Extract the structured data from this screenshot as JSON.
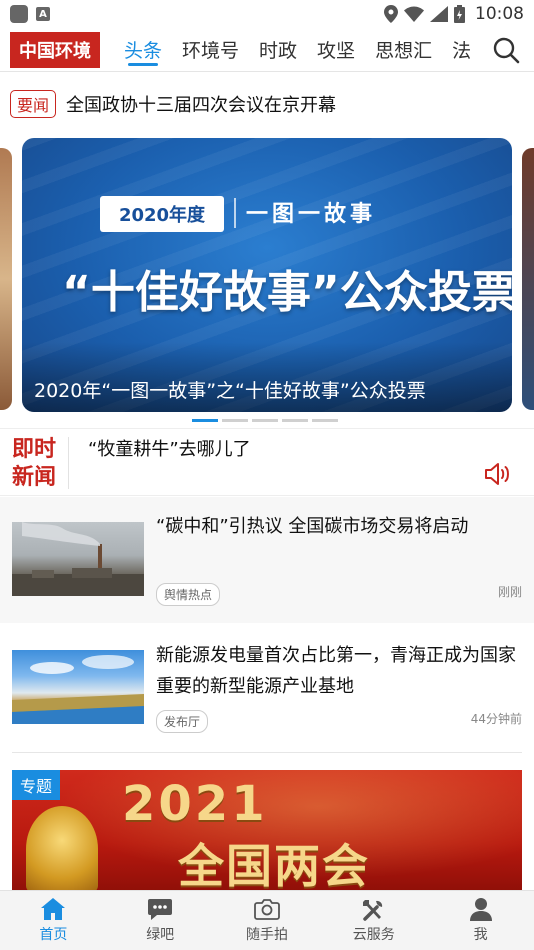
{
  "status_bar": {
    "time": "10:08"
  },
  "header": {
    "logo": "中国环境",
    "tabs": [
      {
        "label": "头条",
        "active": true
      },
      {
        "label": "环境号",
        "active": false
      },
      {
        "label": "时政",
        "active": false
      },
      {
        "label": "攻坚",
        "active": false
      },
      {
        "label": "思想汇",
        "active": false
      },
      {
        "label": "法",
        "active": false
      }
    ]
  },
  "top_headline": {
    "tag": "要闻",
    "text": "全国政协十三届四次会议在京开幕"
  },
  "carousel": {
    "year_badge": "2020年度",
    "series_name": "一图一故事",
    "big_title": "“十佳好故事”公众投票",
    "caption": "2020年“一图一故事”之“十佳好故事”公众投票",
    "total_slides": 5,
    "active_slide": 1
  },
  "flash_news": {
    "label_line1": "即时",
    "label_line2": "新闻",
    "text": "“牧童耕牛”去哪儿了"
  },
  "news": [
    {
      "title": "“碳中和”引热议 全国碳市场交易将启动",
      "tag": "舆情热点",
      "time": "刚刚"
    },
    {
      "title": "新能源发电量首次占比第一，青海正成为国家重要的新型能源产业基地",
      "tag": "发布厅",
      "time": "44分钟前"
    }
  ],
  "feature": {
    "tag": "专题",
    "year": "2021",
    "title": "全国两会"
  },
  "bottom_nav": [
    {
      "label": "首页",
      "icon": "home-icon",
      "active": true
    },
    {
      "label": "绿吧",
      "icon": "chat-icon",
      "active": false
    },
    {
      "label": "随手拍",
      "icon": "camera-icon",
      "active": false
    },
    {
      "label": "云服务",
      "icon": "tools-icon",
      "active": false
    },
    {
      "label": "我",
      "icon": "person-icon",
      "active": false
    }
  ],
  "colors": {
    "accent": "#1a8de0",
    "brand_red": "#c8261f"
  }
}
